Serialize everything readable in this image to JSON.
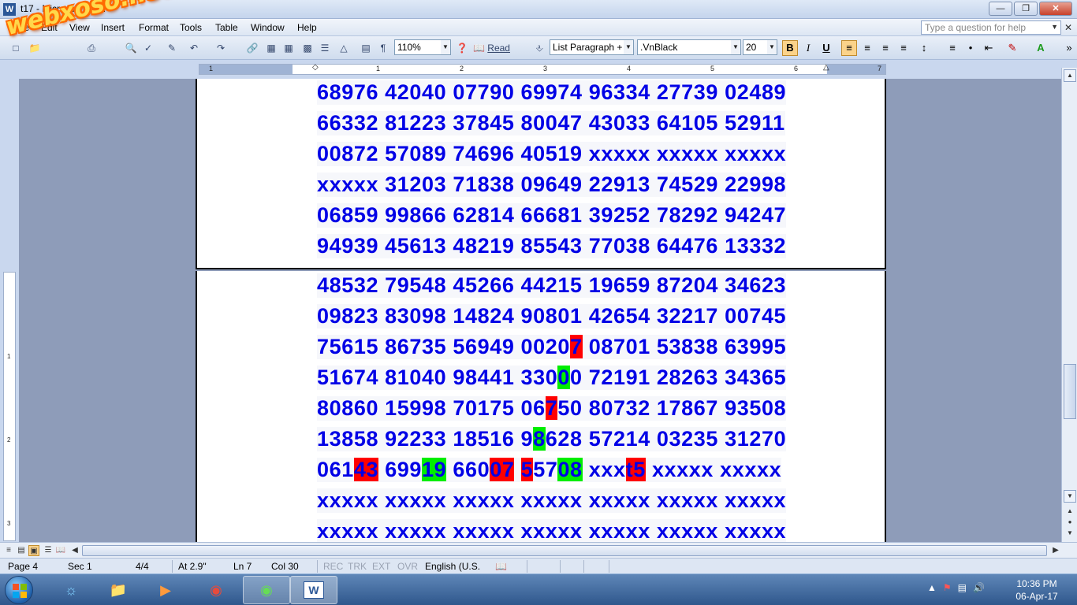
{
  "window": {
    "title": "t17 - Microsoft Word",
    "app_icon_letter": "W"
  },
  "watermark": "webxoso.net",
  "menu": [
    "File",
    "Edit",
    "View",
    "Insert",
    "Format",
    "Tools",
    "Table",
    "Window",
    "Help"
  ],
  "help_placeholder": "Type a question for help",
  "toolbar": {
    "zoom": "110%",
    "read_label": "Read",
    "style": "List Paragraph +",
    "font": ".VnBlack",
    "size": "20",
    "bold": "B",
    "italic": "I",
    "underline": "U"
  },
  "ruler_numbers": [
    "1",
    "1",
    "2",
    "3",
    "4",
    "5",
    "6",
    "7"
  ],
  "vruler_numbers": [
    "1",
    "2",
    "3"
  ],
  "page_top_rows": [
    [
      [
        "68976 42040 07790 69974 96334 27739 02489",
        ""
      ]
    ],
    [
      [
        "66332 81223 37845 80047 43033 64105 52911",
        ""
      ]
    ],
    [
      [
        "00872 57089 74696 40519 xxxxx xxxxx xxxxx",
        ""
      ]
    ],
    [
      [
        "xxxxx 31203 71838 09649 22913 74529 22998",
        ""
      ]
    ],
    [
      [
        "06859 99866 62814 66681 39252 78292 94247",
        ""
      ]
    ],
    [
      [
        "94939 45613 48219 85543 77038 64476 13332",
        ""
      ]
    ]
  ],
  "page_bottom_rows": [
    [
      [
        "48532 79548 45266 44215 19659 87204 34623",
        ""
      ]
    ],
    [
      [
        "09823 83098 14824 90801 42654 32217 00745",
        ""
      ]
    ],
    [
      [
        "75615 86735 56949 0020",
        ""
      ],
      [
        "7",
        "red"
      ],
      [
        " 08701 53838 63995",
        ""
      ]
    ],
    [
      [
        "51674 81040 98441 330",
        ""
      ],
      [
        "0",
        "green"
      ],
      [
        "0 72191 28263 34365",
        ""
      ]
    ],
    [
      [
        "80860 15998 70175 06",
        ""
      ],
      [
        "7",
        "red"
      ],
      [
        "50 80732 17867 93508",
        ""
      ]
    ],
    [
      [
        "13858 92233 18516 9",
        ""
      ],
      [
        "8",
        "green"
      ],
      [
        "628 57214 03235 31270",
        ""
      ]
    ],
    [
      [
        "061",
        ""
      ],
      [
        "43",
        "red"
      ],
      [
        " 699",
        ""
      ],
      [
        "19",
        "green"
      ],
      [
        " 660",
        ""
      ],
      [
        "07",
        "red"
      ],
      [
        " ",
        ""
      ],
      [
        "5",
        "red"
      ],
      [
        "57",
        ""
      ],
      [
        "08",
        "green"
      ],
      [
        " xxx",
        ""
      ],
      [
        "t5",
        "red"
      ],
      [
        " xxxxx xxxxx",
        ""
      ]
    ],
    [
      [
        "xxxxx xxxxx xxxxx xxxxx xxxxx xxxxx xxxxx",
        ""
      ]
    ],
    [
      [
        "xxxxx xxxxx xxxxx xxxxx xxxxx xxxxx xxxxx",
        ""
      ]
    ]
  ],
  "status": {
    "page": "Page 4",
    "sec": "Sec 1",
    "pages": "4/4",
    "at": "At 2.9\"",
    "ln": "Ln 7",
    "col": "Col 30",
    "rec": "REC",
    "trk": "TRK",
    "ext": "EXT",
    "ovr": "OVR",
    "lang": "English (U.S."
  },
  "clock": {
    "time": "10:36 PM",
    "date": "06-Apr-17"
  },
  "colors": {
    "digit_blue": "#0000e6",
    "highlight_red": "#ff0000",
    "highlight_green": "#00ee00"
  }
}
